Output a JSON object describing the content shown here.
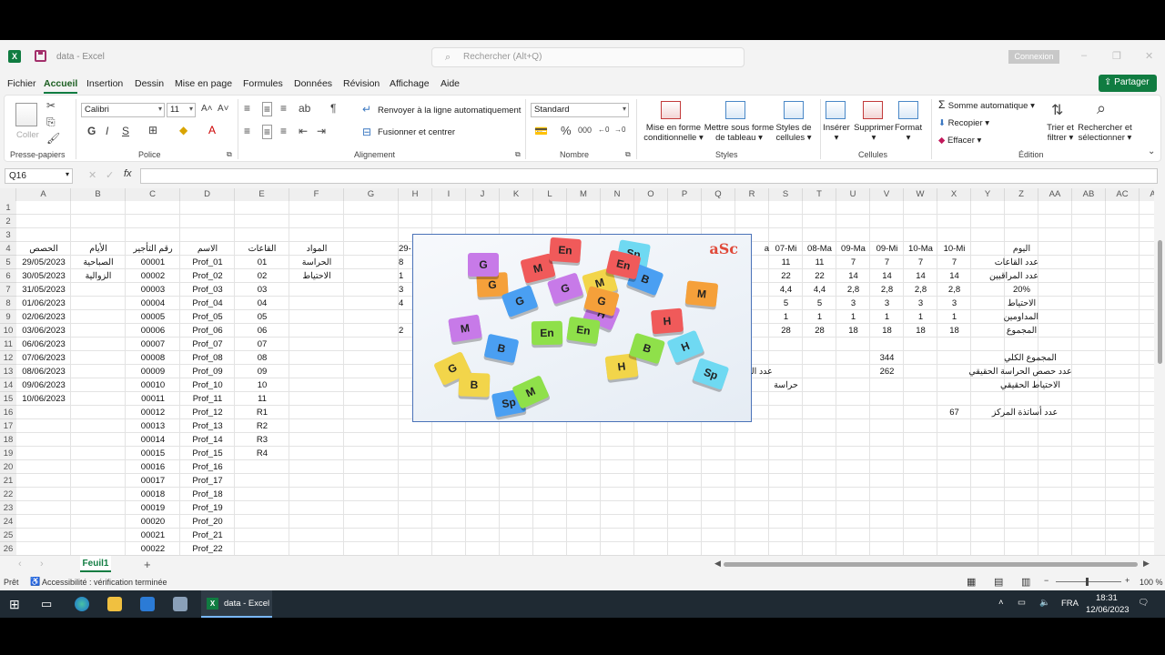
{
  "window": {
    "title": "data  -  Excel",
    "search_placeholder": "Rechercher (Alt+Q)",
    "connexion": "Connexion"
  },
  "menu": [
    "Fichier",
    "Accueil",
    "Insertion",
    "Dessin",
    "Mise en page",
    "Formules",
    "Données",
    "Révision",
    "Affichage",
    "Aide"
  ],
  "share_label": "Partager",
  "ribbon": {
    "paste": "Coller",
    "clipboard": "Presse-papiers",
    "font_name": "Calibri",
    "font_size": "11",
    "font_group": "Police",
    "wrap_text": "Renvoyer à la ligne automatiquement",
    "merge_center": "Fusionner et centrer",
    "alignment_group": "Alignement",
    "number_format": "Standard",
    "number_group": "Nombre",
    "cond_format_1": "Mise en forme",
    "cond_format_2": "conditionnelle",
    "table_format_1": "Mettre sous forme",
    "table_format_2": "de tableau",
    "cell_styles_1": "Styles de",
    "cell_styles_2": "cellules",
    "styles_group": "Styles",
    "insert": "Insérer",
    "delete": "Supprimer",
    "format": "Format",
    "cells_group": "Cellules",
    "autosum": "Somme automatique",
    "fill": "Recopier",
    "clear": "Effacer",
    "sort_1": "Trier et",
    "sort_2": "filtrer",
    "find_1": "Rechercher et",
    "find_2": "sélectionner",
    "editing_group": "Édition"
  },
  "formula_bar": {
    "name_box": "Q16",
    "fx": "fx"
  },
  "columns": [
    "A",
    "B",
    "C",
    "D",
    "E",
    "F",
    "G",
    "H",
    "I",
    "J",
    "K",
    "L",
    "M",
    "N",
    "O",
    "P",
    "Q",
    "R",
    "S",
    "T",
    "U",
    "V",
    "W",
    "X",
    "Y",
    "Z",
    "AA",
    "AB",
    "AC",
    "AD"
  ],
  "rows": [
    "1",
    "2",
    "3",
    "4",
    "5",
    "6",
    "7",
    "8",
    "9",
    "10",
    "11",
    "12",
    "13",
    "14",
    "15",
    "16",
    "17",
    "18",
    "19",
    "20",
    "21",
    "22",
    "23",
    "24",
    "25",
    "26"
  ],
  "sheet": {
    "hdr_A": "الحصص",
    "hdr_B": "الأيام",
    "hdr_C": "رقم التأجير",
    "hdr_D": "الاسم",
    "hdr_E": "القاعات",
    "hdr_F": "المواد",
    "hdr_H": "29-",
    "col_A": [
      "29/05/2023",
      "30/05/2023",
      "31/05/2023",
      "01/06/2023",
      "02/06/2023",
      "03/06/2023",
      "06/06/2023",
      "07/06/2023",
      "08/06/2023",
      "09/06/2023",
      "10/06/2023"
    ],
    "col_B": [
      "الصباحية",
      "الزوالية"
    ],
    "col_C": [
      "00001",
      "00002",
      "00003",
      "00004",
      "00005",
      "00006",
      "00007",
      "00008",
      "00009",
      "00010",
      "00011",
      "00012",
      "00013",
      "00014",
      "00015",
      "00016",
      "00017",
      "00018",
      "00019",
      "00020",
      "00021",
      "00022"
    ],
    "col_D": [
      "Prof_01",
      "Prof_02",
      "Prof_03",
      "Prof_04",
      "Prof_05",
      "Prof_06",
      "Prof_07",
      "Prof_08",
      "Prof_09",
      "Prof_10",
      "Prof_11",
      "Prof_12",
      "Prof_13",
      "Prof_14",
      "Prof_15",
      "Prof_16",
      "Prof_17",
      "Prof_18",
      "Prof_19",
      "Prof_20",
      "Prof_21",
      "Prof_22"
    ],
    "col_E": [
      "01",
      "02",
      "03",
      "04",
      "05",
      "06",
      "07",
      "08",
      "09",
      "10",
      "11",
      "R1",
      "R2",
      "R3",
      "R4"
    ],
    "col_F": [
      "الحراسة",
      "الاحتياط"
    ],
    "col_H_partial": [
      "8",
      "1",
      "3",
      "4",
      "",
      "2"
    ],
    "summary_headers": {
      "R": "a",
      "S": "07-Mi",
      "T": "08-Ma",
      "U": "09-Ma",
      "V": "09-Mi",
      "W": "10-Ma",
      "X": "10-Mi",
      "Z": "اليوم"
    },
    "summary_rows": [
      {
        "values": [
          "11",
          "11",
          "7",
          "7",
          "7",
          "7"
        ],
        "label": "عدد القاعات"
      },
      {
        "values": [
          "22",
          "22",
          "14",
          "14",
          "14",
          "14"
        ],
        "label": "عدد المراقبين"
      },
      {
        "values": [
          "4,4",
          "4,4",
          "2,8",
          "2,8",
          "2,8",
          "2,8"
        ],
        "label": "20%"
      },
      {
        "values": [
          "5",
          "5",
          "3",
          "3",
          "3",
          "3"
        ],
        "label": "الاحتياط"
      },
      {
        "values": [
          "1",
          "1",
          "1",
          "1",
          "1",
          "1"
        ],
        "label": "المداومين"
      },
      {
        "values": [
          "28",
          "28",
          "18",
          "18",
          "18",
          "18"
        ],
        "label": "المجموع"
      }
    ],
    "total_label": "المجموع الكلي",
    "total_value": "344",
    "real_guard_label": "عدد حصص الحراسة الحقيقي",
    "real_guard_value": "262",
    "partial_R13": "عدد الحص",
    "partial_S14": "حراسة",
    "real_reserve_label": "الاحتياط الحقيقي",
    "teachers_label": "عدد أساتذة المركز",
    "teachers_value": "67"
  },
  "picture": {
    "brand": "aSc",
    "tiles": [
      "G",
      "B",
      "En",
      "M",
      "H",
      "Sp",
      "G",
      "M",
      "B",
      "En",
      "H",
      "G",
      "Sp",
      "M",
      "H",
      "G",
      "B",
      "En",
      "M",
      "H",
      "G",
      "B",
      "Sp",
      "M",
      "En",
      "G"
    ]
  },
  "sheet_tab": "Feuil1",
  "status": {
    "ready": "Prêt",
    "accessibility": "Accessibilité : vérification terminée",
    "zoom": "100 %"
  },
  "taskbar": {
    "app": "data - Excel",
    "lang": "FRA",
    "time": "18:31",
    "date": "12/06/2023"
  }
}
